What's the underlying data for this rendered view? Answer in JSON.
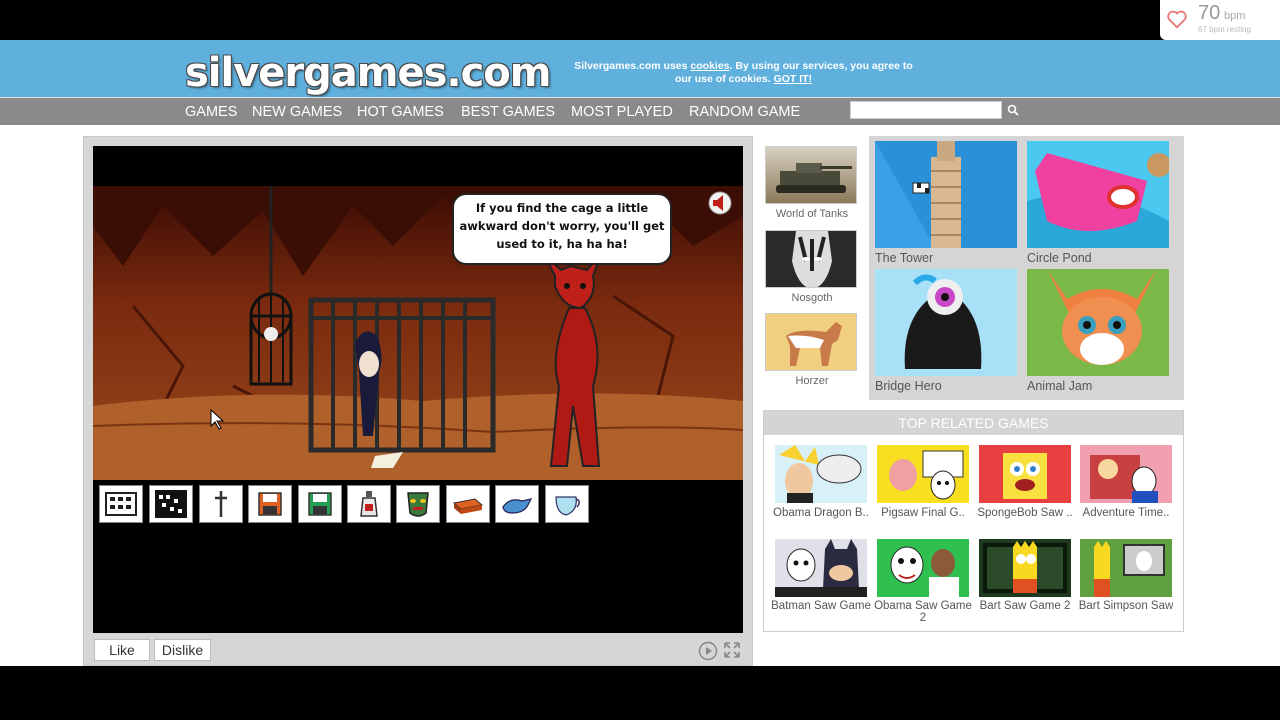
{
  "heart_rate": {
    "value": "70",
    "unit": "bpm",
    "resting": "67 bpm resting",
    "icon": "heart-icon"
  },
  "header": {
    "logo": "silvergames.com",
    "cookie_text_1": "Silvergames.com uses",
    "cookie_link": "cookies",
    "cookie_text_2": ". By using our services, you agree to our use of cookies.",
    "cookie_ok": "GOT IT!"
  },
  "nav": {
    "items": [
      "GAMES",
      "NEW GAMES",
      "HOT GAMES",
      "BEST GAMES",
      "MOST PLAYED",
      "RANDOM GAME"
    ],
    "search_placeholder": "",
    "search_icon": "magnifier-icon"
  },
  "game": {
    "speech": "If you find the cage a little awkward don't worry, you'll get used to it, ha ha ha!",
    "sound_icon": "speaker-icon",
    "inventory": [
      "keypad-icon",
      "grid-icon",
      "sword-icon",
      "floppy-red-icon",
      "floppy-green-icon",
      "bottle-icon",
      "mask-icon",
      "brick-icon",
      "ocarina-icon",
      "pitcher-icon"
    ]
  },
  "controls": {
    "like": "Like",
    "dislike": "Dislike",
    "play_icon": "play-icon",
    "fullscreen_icon": "fullscreen-icon"
  },
  "side_games": [
    "World of Tanks",
    "Nosgoth",
    "Horzer"
  ],
  "featured_games": [
    "The Tower",
    "Circle Pond",
    "Bridge Hero",
    "Animal Jam"
  ],
  "related": {
    "title": "TOP RELATED GAMES",
    "games": [
      "Obama Dragon B..",
      "Pigsaw Final G..",
      "SpongeBob Saw ..",
      "Adventure Time..",
      "Batman Saw Game",
      "Obama Saw Game 2",
      "Bart Saw Game 2",
      "Bart Simpson Saw"
    ]
  },
  "colors": {
    "header_blue": "#5fb0dd",
    "nav_gray": "#8a8a8a",
    "cave_dark": "#5a1a08",
    "devil_red": "#c0201a"
  }
}
